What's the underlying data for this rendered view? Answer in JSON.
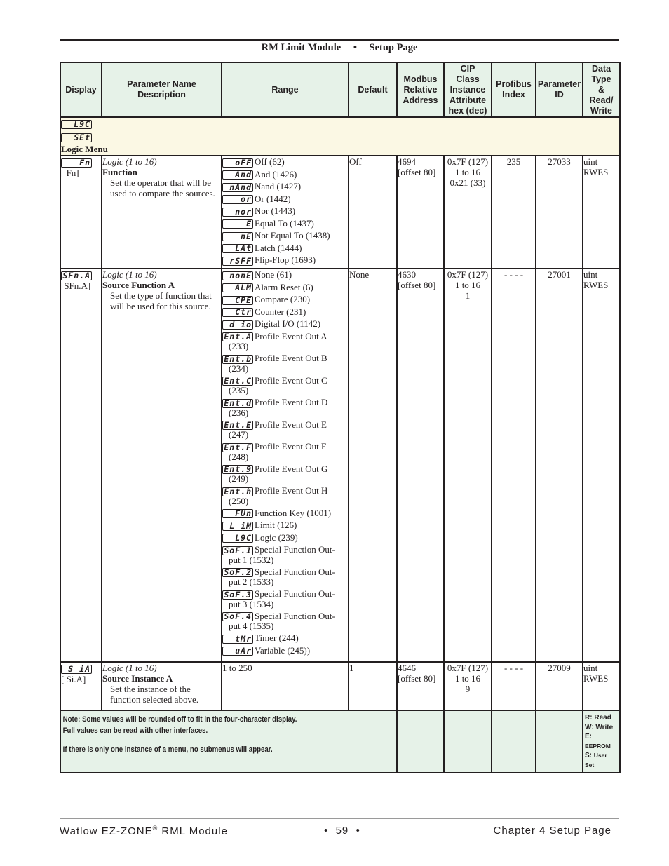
{
  "page_header": {
    "module": "RM Limit Module",
    "separator": "•",
    "section": "Setup Page"
  },
  "table": {
    "headers": [
      "Display",
      "Parameter Name Description",
      "Range",
      "Default",
      "Modbus Relative Address",
      "CIP Class Instance Attribute hex (dec)",
      "Profibus Index",
      "Parameter ID",
      "Data Type & Read/ Write"
    ],
    "menu": {
      "display_top": "L9C",
      "display_bottom": "SEt",
      "title": "Logic Menu"
    },
    "rows": [
      {
        "display": "Fn",
        "display_alt": "[ Fn]",
        "group": "Logic (1 to 16)",
        "name": "Function",
        "description": "Set the operator that will be used to compare the sources.",
        "range": [
          {
            "code": "oFF",
            "label": "Off (62)"
          },
          {
            "code": "And",
            "label": "And (1426)"
          },
          {
            "code": "nAnd",
            "label": "Nand (1427)"
          },
          {
            "code": "or",
            "label": "Or (1442)"
          },
          {
            "code": "nor",
            "label": "Nor (1443)"
          },
          {
            "code": "E",
            "label": "Equal To (1437)"
          },
          {
            "code": "nE",
            "label": "Not Equal To (1438)"
          },
          {
            "code": "LAt",
            "label": "Latch (1444)"
          },
          {
            "code": "rSFF",
            "label": "Flip-Flop (1693)"
          }
        ],
        "default": "Off",
        "modbus": [
          "4694",
          "[offset 80]"
        ],
        "cip": [
          "0x7F (127)",
          "1 to 16",
          "0x21 (33)"
        ],
        "profibus": "235",
        "param_id": "27033",
        "data_type": [
          "uint",
          "RWES"
        ]
      },
      {
        "display": "SFn.A",
        "display_alt": "[SFn.A]",
        "group": "Logic (1 to 16)",
        "name": "Source Function A",
        "description": "Set the type of function that will be used for this source.",
        "range": [
          {
            "code": "nonE",
            "label": "None (61)"
          },
          {
            "code": "ALM",
            "label": "Alarm Reset (6)"
          },
          {
            "code": "CPE",
            "label": "Compare (230)"
          },
          {
            "code": "Ctr",
            "label": "Counter (231)"
          },
          {
            "code": "d io",
            "label": "Digital I/O (1142)"
          },
          {
            "code": "Ent.A",
            "label": "Profile Event Out A",
            "cont": "(233)"
          },
          {
            "code": "Ent.b",
            "label": "Profile Event Out B",
            "cont": "(234)"
          },
          {
            "code": "Ent.C",
            "label": "Profile Event Out C",
            "cont": "(235)"
          },
          {
            "code": "Ent.d",
            "label": "Profile Event Out D",
            "cont": "(236)"
          },
          {
            "code": "Ent.E",
            "label": "Profile Event Out E",
            "cont": "(247)"
          },
          {
            "code": "Ent.F",
            "label": "Profile Event Out F",
            "cont": "(248)"
          },
          {
            "code": "Ent.9",
            "label": "Profile Event Out G",
            "cont": "(249)"
          },
          {
            "code": "Ent.h",
            "label": "Profile Event Out H",
            "cont": "(250)"
          },
          {
            "code": "FUn",
            "label": "Function Key (1001)"
          },
          {
            "code": "L iM",
            "label": "Limit (126)"
          },
          {
            "code": "L9C",
            "label": "Logic (239)"
          },
          {
            "code": "SoF.1",
            "label": "Special Function Out-",
            "cont": "put 1 (1532)"
          },
          {
            "code": "SoF.2",
            "label": "Special Function Out-",
            "cont": "put 2 (1533)"
          },
          {
            "code": "SoF.3",
            "label": "Special Function Out-",
            "cont": "put 3 (1534)"
          },
          {
            "code": "SoF.4",
            "label": "Special Function Out-",
            "cont": "put 4 (1535)"
          },
          {
            "code": "tMr",
            "label": "Timer (244)"
          },
          {
            "code": "uAr",
            "label": "Variable (245))"
          }
        ],
        "default": "None",
        "modbus": [
          "4630",
          "[offset 80]"
        ],
        "cip": [
          "0x7F (127)",
          "1 to 16",
          "1"
        ],
        "profibus": "- - - -",
        "param_id": "27001",
        "data_type": [
          "uint",
          "RWES"
        ]
      },
      {
        "display": "S iA",
        "display_alt": "[ Si.A]",
        "group": "Logic (1 to 16)",
        "name": "Source Instance A",
        "description": "Set the instance of the function selected above.",
        "range_text": "1 to 250",
        "default": "1",
        "modbus": [
          "4646",
          "[offset 80]"
        ],
        "cip": [
          "0x7F (127)",
          "1 to 16",
          "9"
        ],
        "profibus": "- - - -",
        "param_id": "27009",
        "data_type": [
          "uint",
          "RWES"
        ]
      }
    ],
    "note": {
      "lines": [
        "Note: Some values will be rounded off to fit in the four-character display.",
        "Full values can be read with other interfaces.",
        "",
        "If there is only one instance of a menu, no submenus will appear."
      ],
      "legend": [
        {
          "key": "R:",
          "value": "Read"
        },
        {
          "key": "W:",
          "value": "Write"
        },
        {
          "key": "E:",
          "value": "EEPROM"
        },
        {
          "key": "S:",
          "value": "User Set"
        }
      ]
    }
  },
  "footer": {
    "left": "Watlow EZ-ZONE",
    "left_reg": "®",
    "left_suffix": " RML Module",
    "center": "•  59  •",
    "right": "Chapter 4 Setup Page"
  }
}
